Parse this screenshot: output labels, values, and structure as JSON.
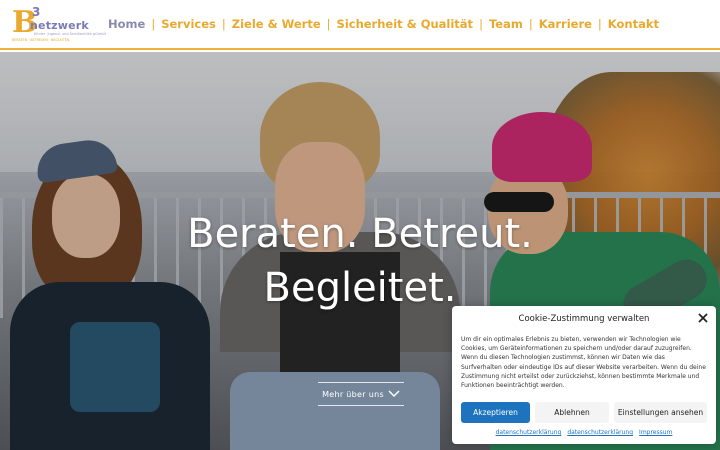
{
  "logo": {
    "letter": "B",
    "superscript": "3",
    "word": "netzwerk",
    "tagline": "Kinder, Jugend- und Familienhilfe gGmbH",
    "subline": "BERATEN · BETREUEN · BEGLEITEN"
  },
  "nav": {
    "items": [
      {
        "label": "Home",
        "active": true
      },
      {
        "label": "Services",
        "active": false
      },
      {
        "label": "Ziele & Werte",
        "active": false
      },
      {
        "label": "Sicherheit & Qualität",
        "active": false
      },
      {
        "label": "Team",
        "active": false
      },
      {
        "label": "Karriere",
        "active": false
      },
      {
        "label": "Kontakt",
        "active": false
      }
    ],
    "separator": "|"
  },
  "hero": {
    "line1": "Beraten. Betreut.",
    "line2": "Begleitet.",
    "cta": "Mehr über uns"
  },
  "cookie": {
    "title": "Cookie-Zustimmung verwalten",
    "text": "Um dir ein optimales Erlebnis zu bieten, verwenden wir Technologien wie Cookies, um Geräteinformationen zu speichern und/oder darauf zuzugreifen. Wenn du diesen Technologien zustimmst, können wir Daten wie das Surfverhalten oder eindeutige IDs auf dieser Website verarbeiten. Wenn du deine Zustimmung nicht erteilst oder zurückziehst, können bestimmte Merkmale und Funktionen beeinträchtigt werden.",
    "accept": "Akzeptieren",
    "deny": "Ablehnen",
    "prefs": "Einstellungen ansehen",
    "links": [
      "datenschutzerklärung",
      "datenschutzerklärung",
      "Impressum"
    ]
  },
  "colors": {
    "accent": "#e9a92f",
    "nav_active": "#8a8aae",
    "button_primary": "#1e73be"
  }
}
